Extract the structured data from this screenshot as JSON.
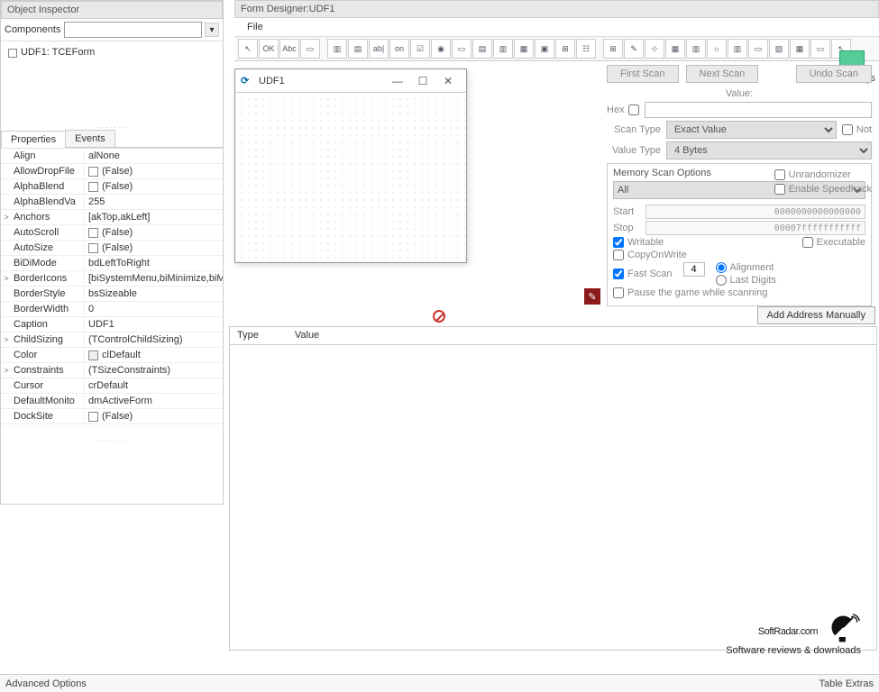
{
  "inspector": {
    "title": "Object Inspector",
    "components_label": "Components",
    "tree_item": "UDF1: TCEForm",
    "tabs": {
      "properties": "Properties",
      "events": "Events"
    },
    "props": [
      {
        "name": "Align",
        "val": "alNone",
        "exp": ""
      },
      {
        "name": "AllowDropFile",
        "val": "(False)",
        "exp": "",
        "chk": true
      },
      {
        "name": "AlphaBlend",
        "val": "(False)",
        "exp": "",
        "chk": true
      },
      {
        "name": "AlphaBlendVa",
        "val": "255",
        "exp": ""
      },
      {
        "name": "Anchors",
        "val": "[akTop,akLeft]",
        "exp": ">"
      },
      {
        "name": "AutoScroll",
        "val": "(False)",
        "exp": "",
        "chk": true
      },
      {
        "name": "AutoSize",
        "val": "(False)",
        "exp": "",
        "chk": true
      },
      {
        "name": "BiDiMode",
        "val": "bdLeftToRight",
        "exp": ""
      },
      {
        "name": "BorderIcons",
        "val": "[biSystemMenu,biMinimize,biM",
        "exp": ">"
      },
      {
        "name": "BorderStyle",
        "val": "bsSizeable",
        "exp": ""
      },
      {
        "name": "BorderWidth",
        "val": "0",
        "exp": ""
      },
      {
        "name": "Caption",
        "val": "UDF1",
        "exp": ""
      },
      {
        "name": "ChildSizing",
        "val": "(TControlChildSizing)",
        "exp": ">"
      },
      {
        "name": "Color",
        "val": "clDefault",
        "exp": "",
        "swatch": true
      },
      {
        "name": "Constraints",
        "val": "(TSizeConstraints)",
        "exp": ">"
      },
      {
        "name": "Cursor",
        "val": "crDefault",
        "exp": ""
      },
      {
        "name": "DefaultMonito",
        "val": "dmActiveForm",
        "exp": ""
      },
      {
        "name": "DockSite",
        "val": "(False)",
        "exp": "",
        "chk": true
      }
    ]
  },
  "designer": {
    "title": "Form Designer:UDF1",
    "menu_file": "File",
    "window_title": "UDF1",
    "toolbar_icons": [
      "↖",
      "OK",
      "Abc",
      "▭",
      "",
      "▥",
      "▤",
      "ab|",
      "on",
      "☑",
      "◉",
      "▭",
      "▤",
      "▥",
      "▦",
      "▣",
      "⊞",
      "☷",
      "",
      "⊞",
      "✎",
      "⊹",
      "▦",
      "▥",
      "☼",
      "▥",
      "▭",
      "▧",
      "▦",
      "▭",
      "↖"
    ]
  },
  "scan": {
    "first": "First Scan",
    "next": "Next Scan",
    "undo": "Undo Scan",
    "value_label": "Value:",
    "hex_label": "Hex",
    "scan_type_label": "Scan Type",
    "scan_type_val": "Exact Value",
    "not_label": "Not",
    "value_type_label": "Value Type",
    "value_type_val": "4 Bytes",
    "mem_title": "Memory Scan Options",
    "all": "All",
    "start_label": "Start",
    "start_val": "0000000000000000",
    "stop_label": "Stop",
    "stop_val": "00007fffffffffff",
    "writable": "Writable",
    "executable": "Executable",
    "cow": "CopyOnWrite",
    "fast": "Fast Scan",
    "fast_val": "4",
    "alignment": "Alignment",
    "last_digits": "Last Digits",
    "pause": "Pause the game while scanning",
    "unrand": "Unrandomizer",
    "speedhack": "Enable Speedhack",
    "settings": "Settings"
  },
  "addr": {
    "add_btn": "Add Address Manually",
    "col_type": "Type",
    "col_value": "Value"
  },
  "watermark": {
    "brand": "SoftRadar.com",
    "tag": "Software reviews & downloads"
  },
  "status": {
    "left": "Advanced Options",
    "right": "Table Extras"
  }
}
